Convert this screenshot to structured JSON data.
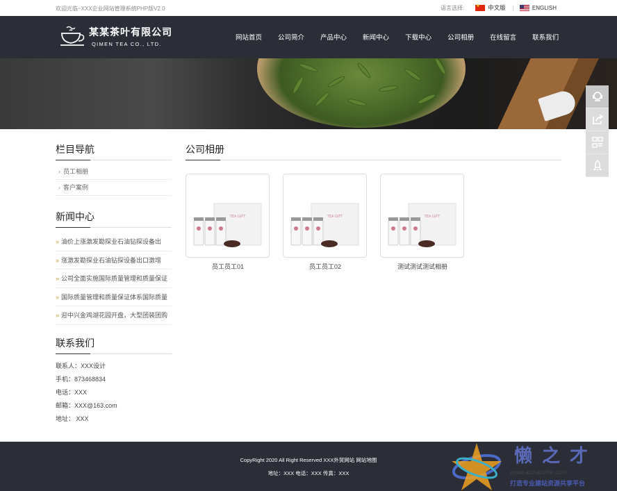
{
  "topbar": {
    "welcome": "欢迎光临~XXX企业网站管理系统PHP版V2.0",
    "lang_label": "语言选择:",
    "lang_cn": "中文版",
    "lang_sep": "|",
    "lang_en": "ENGLISH"
  },
  "header": {
    "logo_cn": "某某茶叶有限公司",
    "logo_en": "QIMEN TEA CO., LTD.",
    "nav": [
      "网站首页",
      "公司简介",
      "产品中心",
      "新闻中心",
      "下载中心",
      "公司相册",
      "在线留言",
      "联系我们"
    ]
  },
  "sidebar": {
    "nav_title": "栏目导航",
    "categories": [
      "员工相册",
      "客户案例"
    ],
    "news_title": "新闻中心",
    "news": [
      "油价上涨激发勘探业石油钻探设备出",
      "涨激发勘探业石油钻探设备出口激增",
      "公司全面实施国际质量管理和质量保证",
      "国际质量管理和质量保证体系国际质量",
      "迎中兴金鸡湖花园开盘，大型团装团购"
    ],
    "contact_title": "联系我们",
    "contact": [
      "联系人：XXX设计",
      "手机：873468834",
      "电话：XXX",
      "邮箱：XXX@163.com",
      "地址：  XXX"
    ]
  },
  "main": {
    "title": "公司相册",
    "albums": [
      {
        "caption": "员工员工01"
      },
      {
        "caption": "员工员工02"
      },
      {
        "caption": "测试测试测试相册"
      }
    ]
  },
  "footer": {
    "line1": "CopyRight 2020 All Right Reserved XXX外贸网站 网站地图",
    "line2": "地址：XXX  电话：XXX  传真：XXX"
  },
  "watermark": {
    "brand": "懒之才",
    "url": "www.aizhanzhe.com",
    "slogan": "打造专业建站资源共享平台"
  },
  "colors": {
    "header_bg": "#2b2e37",
    "accent_gold": "#c8a03c"
  }
}
